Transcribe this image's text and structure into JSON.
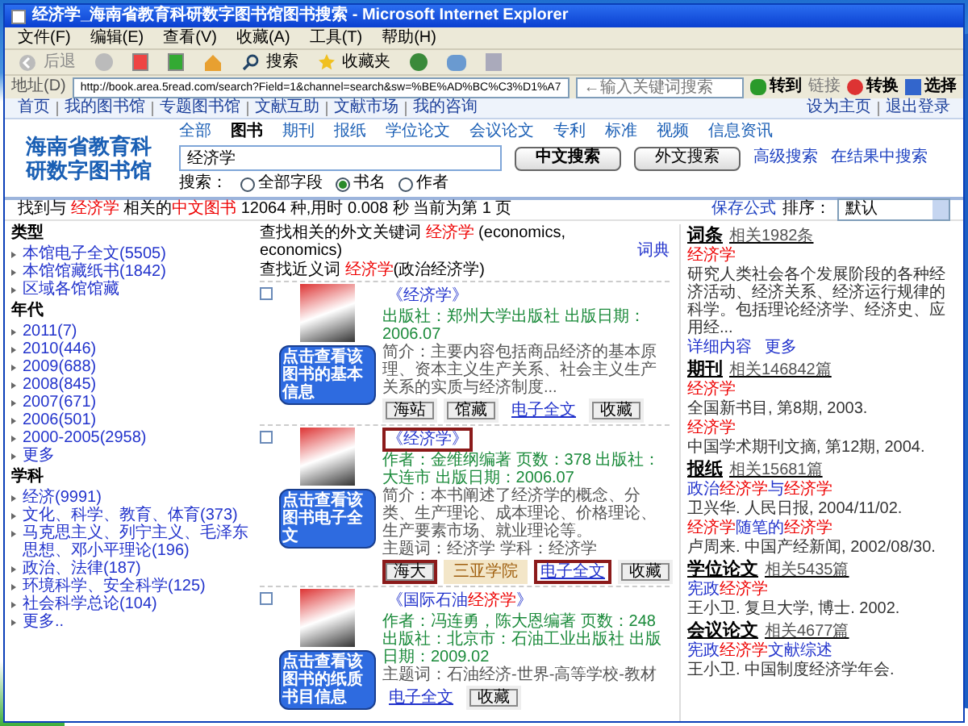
{
  "window": {
    "title": "经济学_海南省教育科研数字图书馆图书搜索 - Microsoft Internet Explorer"
  },
  "menu": [
    "文件(F)",
    "编辑(E)",
    "查看(V)",
    "收藏(A)",
    "工具(T)",
    "帮助(H)"
  ],
  "toolbar": {
    "back": "后退",
    "search": "搜索",
    "favorites": "收藏夹"
  },
  "address_bar": {
    "label": "地址(D)",
    "url": "http://book.area.5read.com/search?Field=1&channel=search&sw=%BE%AD%BC%C3%D1%A7",
    "search_placeholder": "←输入关键词搜索",
    "go": "转到",
    "links": "链接",
    "convert": "转换",
    "select": "选择"
  },
  "site_nav": {
    "left": [
      "首页",
      "我的图书馆",
      "专题图书馆",
      "文献互助",
      "文献市场",
      "我的咨询"
    ],
    "right": [
      "设为主页",
      "退出登录"
    ]
  },
  "logo": "海南省教育科研数字图书馆",
  "tabs": [
    {
      "label": "全部",
      "selected": false
    },
    {
      "label": "图书",
      "selected": true
    },
    {
      "label": "期刊",
      "selected": false
    },
    {
      "label": "报纸",
      "selected": false
    },
    {
      "label": "学位论文",
      "selected": false
    },
    {
      "label": "会议论文",
      "selected": false
    },
    {
      "label": "专利",
      "selected": false
    },
    {
      "label": "标准",
      "selected": false
    },
    {
      "label": "视频",
      "selected": false
    },
    {
      "label": "信息资讯",
      "selected": false
    }
  ],
  "search": {
    "value": "经济学",
    "buttons": [
      "中文搜索",
      "外文搜索"
    ],
    "links": [
      "高级搜索",
      "在结果中搜索"
    ],
    "scope_label": "搜索：",
    "scopes": [
      {
        "label": "全部字段",
        "selected": false
      },
      {
        "label": "书名",
        "selected": true
      },
      {
        "label": "作者",
        "selected": false
      }
    ]
  },
  "result_summary": [
    {
      "t": "找到与 ",
      "hl": false
    },
    {
      "t": "经济学",
      "hl": true
    },
    {
      "t": " 相关的",
      "hl": false
    },
    {
      "t": "中文图书",
      "hl": true
    },
    {
      "t": " 12064 种,用时 0.008 秒 当前为第 1 页",
      "hl": false
    }
  ],
  "save_formula": "保存公式",
  "sort": {
    "label": "排序：",
    "value": "默认"
  },
  "facets": [
    {
      "title": "类型",
      "items": [
        "本馆电子全文(5505)",
        "本馆馆藏纸书(1842)",
        "区域各馆馆藏"
      ]
    },
    {
      "title": "年代",
      "items": [
        "2011(7)",
        "2010(446)",
        "2009(688)",
        "2008(845)",
        "2007(671)",
        "2006(501)",
        "2000-2005(2958)",
        "更多"
      ]
    },
    {
      "title": "学科",
      "items": [
        "经济(9991)",
        "文化、科学、教育、体育(373)",
        "马克思主义、列宁主义、毛泽东思想、邓小平理论(196)",
        "政治、法律(187)",
        "环境科学、安全科学(125)",
        "社会科学总论(104)",
        "更多.."
      ]
    }
  ],
  "related_foreign": [
    {
      "t": "查找相关的外文关键词 ",
      "hl": false
    },
    {
      "t": "经济学",
      "hl": true
    },
    {
      "t": " (economics, economics) ",
      "hl": false
    }
  ],
  "dictionary_link": "词典",
  "synonyms": [
    {
      "t": "查找近义词 ",
      "hl": false
    },
    {
      "t": "经济学",
      "hl": true
    },
    {
      "t": "(政治经济学)",
      "hl": false
    }
  ],
  "books": [
    {
      "checked": false,
      "title": [
        {
          "t": "《经济学》",
          "hl": false
        }
      ],
      "highlighted": false,
      "meta": "出版社：郑州大学出版社 出版日期：2006.07",
      "intro": "简介：主要内容包括商品经济的基本原理、资本主义生产关系、社会主义生产关系的实质与经济制度...",
      "actions": [
        {
          "kind": "button",
          "label": "海站",
          "highlighted": false
        },
        {
          "kind": "button",
          "label": "馆藏",
          "highlighted": false
        },
        {
          "kind": "link",
          "label": "电子全文",
          "highlighted": false
        },
        {
          "kind": "button",
          "label": "收藏",
          "highlighted": false
        }
      ]
    },
    {
      "checked": false,
      "title": [
        {
          "t": "《经济学》",
          "hl": false
        }
      ],
      "highlighted": true,
      "meta": "作者：金维纲编著 页数：378 出版社：大连市 出版日期：2006.07",
      "intro": "简介：本书阐述了经济学的概念、分类、生产理论、成本理论、价格理论、生产要素市场、就业理论等。",
      "subject": "主题词：经济学 学科：经济学",
      "actions": [
        {
          "kind": "button",
          "label": "海大",
          "highlighted": true
        },
        {
          "kind": "tag",
          "label": "三亚学院",
          "highlighted": false
        },
        {
          "kind": "link",
          "label": "电子全文",
          "highlighted": true
        },
        {
          "kind": "button",
          "label": "收藏",
          "highlighted": false
        }
      ]
    },
    {
      "checked": false,
      "title": [
        {
          "t": "《国际石油",
          "hl": false
        },
        {
          "t": "经济学",
          "hl": true
        },
        {
          "t": "》",
          "hl": false
        }
      ],
      "highlighted": false,
      "meta": "作者：冯连勇，陈大恩编著 页数：248 出版社：北京市：石油工业出版社 出版日期：2009.02",
      "subject": "主题词：石油经济-世界-高等学校-教材",
      "actions": [
        {
          "kind": "link",
          "label": "电子全文",
          "highlighted": false
        },
        {
          "kind": "button",
          "label": "收藏",
          "highlighted": false
        }
      ]
    }
  ],
  "related": [
    {
      "heading": "词条",
      "count": "相关1982条",
      "entries": [
        {
          "title": [
            {
              "t": "经济学",
              "hl": true
            }
          ],
          "detail": "研究人类社会各个发展阶段的各种经济活动、经济关系、经济运行规律的科学。包括理论经济学、经济史、应用经..."
        }
      ],
      "links": [
        "详细内容",
        "更多"
      ]
    },
    {
      "heading": "期刊",
      "count": "相关146842篇",
      "entries": [
        {
          "title": [
            {
              "t": "经济学",
              "hl": true
            }
          ],
          "detail": "全国新书目, 第8期, 2003."
        },
        {
          "title": [
            {
              "t": "经济学",
              "hl": true
            }
          ],
          "detail": "中国学术期刊文摘, 第12期, 2004."
        }
      ]
    },
    {
      "heading": "报纸",
      "count": "相关15681篇",
      "entries": [
        {
          "title": [
            {
              "t": "政治",
              "hl": false
            },
            {
              "t": "经济学",
              "hl": true
            },
            {
              "t": "与",
              "hl": false
            },
            {
              "t": "经济学",
              "hl": true
            }
          ],
          "detail": "卫兴华. 人民日报, 2004/11/02."
        },
        {
          "title": [
            {
              "t": "经济学",
              "hl": true
            },
            {
              "t": "随笔的",
              "hl": false
            },
            {
              "t": "经济学",
              "hl": true
            }
          ],
          "detail": "卢周来. 中国产经新闻, 2002/08/30."
        }
      ]
    },
    {
      "heading": "学位论文",
      "count": "相关5435篇",
      "entries": [
        {
          "title": [
            {
              "t": "宪政",
              "hl": false
            },
            {
              "t": "经济学",
              "hl": true
            }
          ],
          "detail": "王小卫. 复旦大学, 博士. 2002."
        }
      ]
    },
    {
      "heading": "会议论文",
      "count": "相关4677篇",
      "entries": [
        {
          "title": [
            {
              "t": "宪政",
              "hl": false
            },
            {
              "t": "经济学",
              "hl": true
            },
            {
              "t": "文献综述",
              "hl": false
            }
          ],
          "detail": "王小卫. 中国制度经济学年会."
        }
      ]
    }
  ],
  "callouts": [
    {
      "text": "点击查看该图书的基本信息"
    },
    {
      "text": "点击查看该图书电子全文"
    },
    {
      "text": "点击查看该图书的纸质书目信息"
    }
  ]
}
